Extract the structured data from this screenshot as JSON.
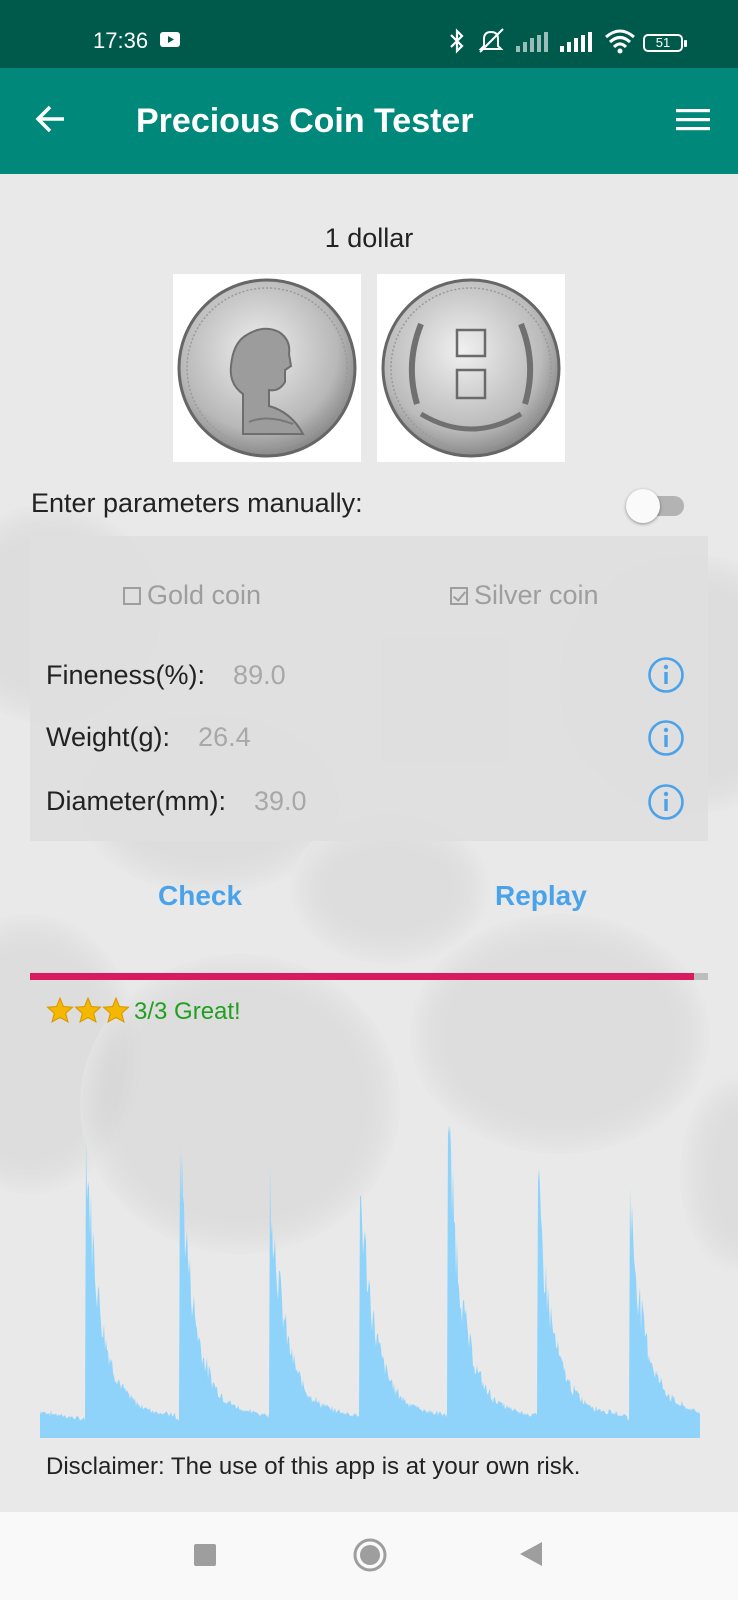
{
  "status_bar": {
    "time": "17:36",
    "battery": "51",
    "icons": [
      "youtube-icon",
      "bluetooth-icon",
      "mute-icon",
      "signal-icon",
      "signal-icon",
      "wifi-icon",
      "battery-icon"
    ]
  },
  "app_bar": {
    "title": "Precious Coin Tester",
    "back_icon": "arrow-left-icon",
    "menu_icon": "hamburger-menu-icon",
    "color": "#00897b"
  },
  "coin": {
    "name": "1 dollar"
  },
  "manual": {
    "label": "Enter parameters manually:",
    "enabled": false
  },
  "params": {
    "gold_label": "Gold coin",
    "gold_checked": false,
    "silver_label": "Silver coin",
    "silver_checked": true,
    "fineness_label": "Fineness(%):",
    "fineness_value": "89.0",
    "weight_label": "Weight(g):",
    "weight_value": "26.4",
    "diameter_label": "Diameter(mm):",
    "diameter_value": "39.0"
  },
  "buttons": {
    "check": "Check",
    "replay": "Replay"
  },
  "progress": {
    "fraction": 0.98,
    "color": "#d81b60"
  },
  "result": {
    "stars": 3,
    "text": "3/3 Great!",
    "color": "#20a020"
  },
  "disclaimer": "Disclaimer: The use of this app is at your own risk.",
  "nav": {
    "icons": [
      "recents-square-icon",
      "home-circle-icon",
      "back-triangle-icon"
    ]
  }
}
